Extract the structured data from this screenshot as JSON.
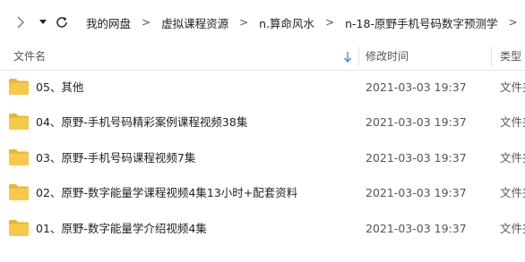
{
  "nav": {
    "icons": [
      "chevron-right-icon",
      "chevron-down-icon",
      "refresh-icon"
    ],
    "breadcrumbs": [
      "我的网盘",
      "虚拟课程资源",
      "n.算命风水",
      "n-18-原野手机号码数字预测学"
    ]
  },
  "header": {
    "name_label": "文件名",
    "modified_label": "修改时间",
    "type_label": "类型"
  },
  "files": [
    {
      "name": "05、其他",
      "modified": "2021-03-03 19:37",
      "type": "文件夹"
    },
    {
      "name": "04、原野-手机号码精彩案例课程视频38集",
      "modified": "2021-03-03 19:37",
      "type": "文件夹"
    },
    {
      "name": "03、原野-手机号码课程视频7集",
      "modified": "2021-03-03 19:37",
      "type": "文件夹"
    },
    {
      "name": "02、原野-数字能量学课程视频4集13小时+配套资料",
      "modified": "2021-03-03 19:37",
      "type": "文件夹"
    },
    {
      "name": "01、原野-数字能量学介绍视频4集",
      "modified": "2021-03-03 19:37",
      "type": "文件夹"
    }
  ],
  "colors": {
    "folder": "#F7C948",
    "folder_back": "#E9B52F",
    "sort_arrow": "#3C8DDB"
  }
}
